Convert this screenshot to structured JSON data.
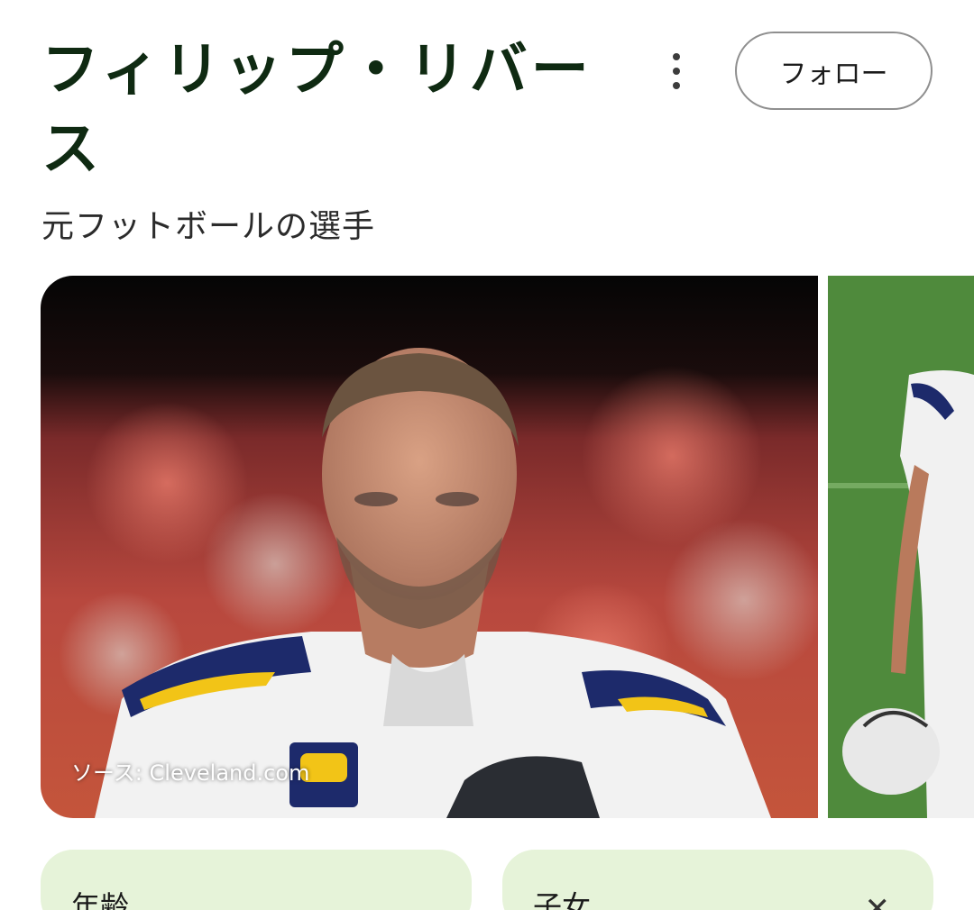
{
  "header": {
    "title": "フィリップ・リバース",
    "subtitle": "元フットボールの選手",
    "follow_label": "フォロー",
    "more_icon": "more-vert-icon"
  },
  "images": {
    "main_source": "ソース: Cleveland.com"
  },
  "cards": {
    "age_label": "年齢",
    "children_label": "子女",
    "close_icon": "close-icon",
    "close_glyph": "✕"
  },
  "colors": {
    "title": "#0f2a12",
    "card_bg": "#e6f3d9",
    "follow_border": "#8f8f8f"
  }
}
